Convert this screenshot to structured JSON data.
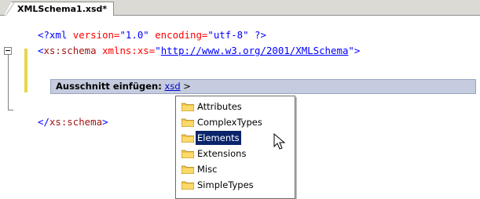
{
  "tab": {
    "title": "XMLSchema1.xsd*"
  },
  "code": {
    "line1": {
      "decl_open": "<?xml",
      "attr1": " version=",
      "val1": "\"1.0\"",
      "attr2": " encoding=",
      "val2": "\"utf-8\"",
      "decl_close": " ?>"
    },
    "line2": {
      "open": "<",
      "tag": "xs:schema",
      "attr": " xmlns:xs=",
      "quote1": "\"",
      "url": "http://www.w3.org/2001/XMLSchema",
      "quote2": "\"",
      "close": ">"
    },
    "line3": {
      "open": "</",
      "tag": "xs:schema",
      "close": ">"
    }
  },
  "snippet_bar": {
    "label": "Ausschnitt einfügen:",
    "link": "xsd",
    "arrow": ">"
  },
  "menu": {
    "items": [
      {
        "label": "Attributes"
      },
      {
        "label": "ComplexTypes"
      },
      {
        "label": "Elements"
      },
      {
        "label": "Extensions"
      },
      {
        "label": "Misc"
      },
      {
        "label": "SimpleTypes"
      }
    ],
    "selected": "Elements"
  },
  "colors": {
    "folder": "#f4c84a",
    "selection": "#0a246a",
    "snippet_bar": "#c5ccdf",
    "changebar": "#e8d44d"
  }
}
